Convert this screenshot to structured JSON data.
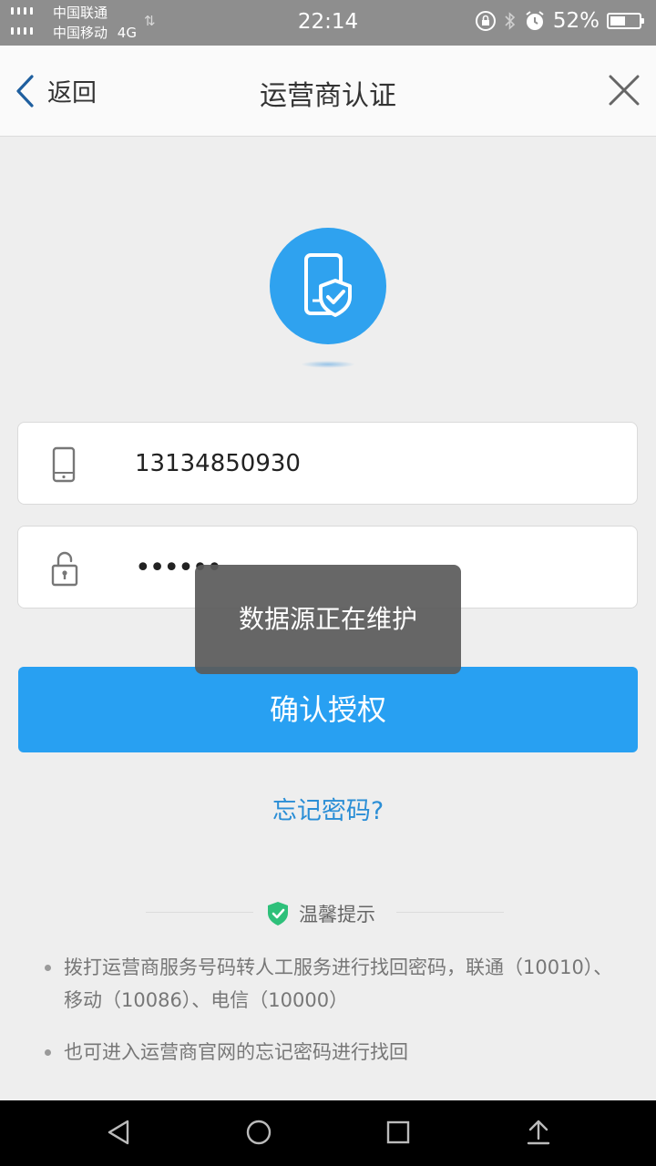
{
  "status_bar": {
    "carrier_1": "中国联通",
    "carrier_2": "中国移动",
    "network_type": "4G",
    "time": "22:14",
    "battery_percent": "52%",
    "battery_level": 0.52
  },
  "header": {
    "back_label": "返回",
    "title": "运营商认证"
  },
  "form": {
    "phone_value": "13134850930",
    "password_value": "123456"
  },
  "toast": {
    "message": "数据源正在维护"
  },
  "actions": {
    "confirm_label": "确认授权",
    "forgot_label": "忘记密码?"
  },
  "tips": {
    "title": "温馨提示",
    "items": [
      "拨打运营商服务号码转人工服务进行找回密码，联通（10010）、移动（10086）、电信（10000）",
      "也可进入运营商官网的忘记密码进行找回"
    ]
  },
  "colors": {
    "accent": "#28a0f2",
    "link": "#2a8ed6",
    "tips_shield": "#2ec07a"
  }
}
